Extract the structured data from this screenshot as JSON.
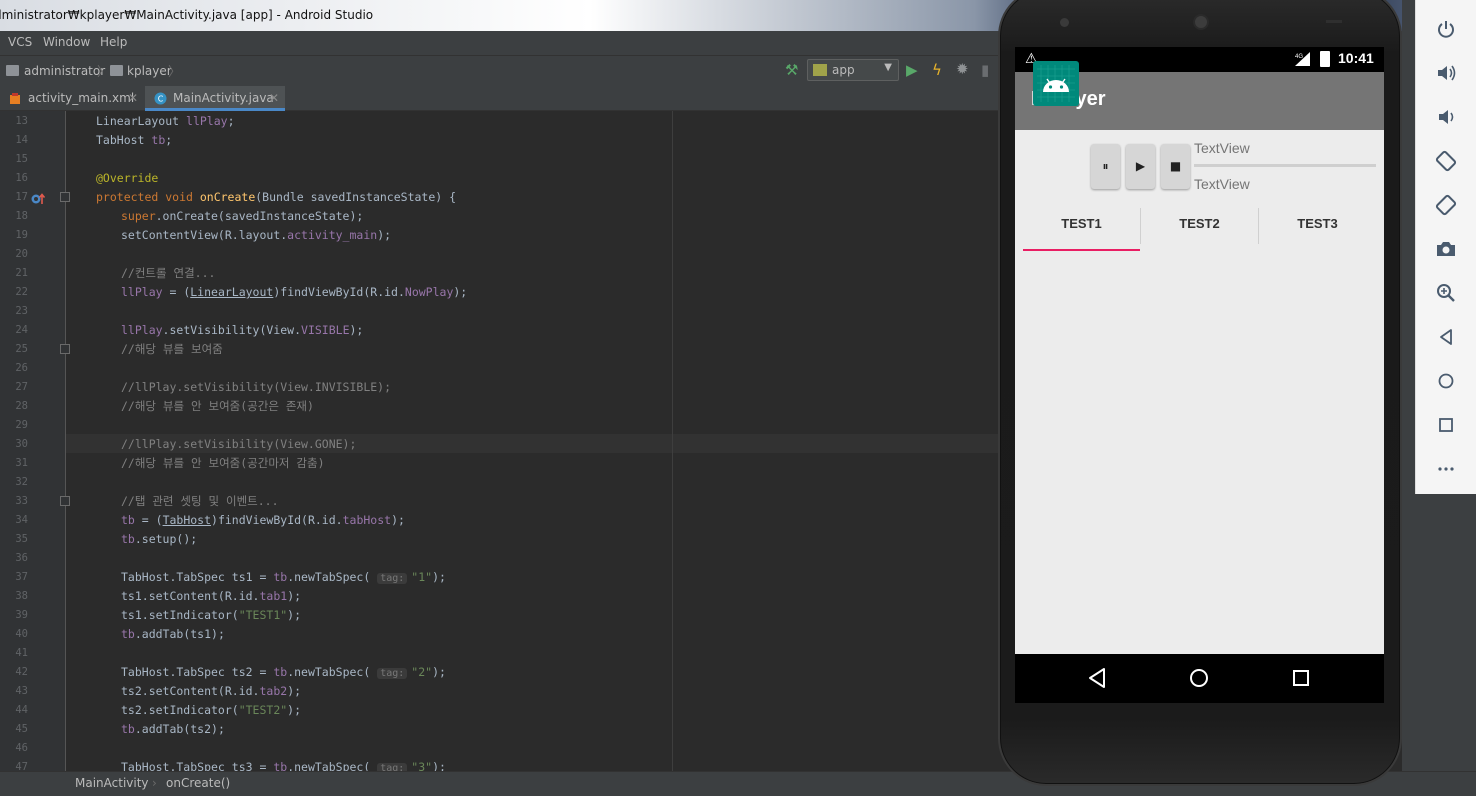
{
  "window": {
    "title": "dministrator₩kplayer₩MainActivity.java [app] - Android Studio"
  },
  "menu": [
    "VCS",
    "Window",
    "Help"
  ],
  "nav": {
    "crumbs": [
      "administrator",
      "kplayer"
    ],
    "run_config": "app"
  },
  "editor_tabs": [
    {
      "label": "activity_main.xml",
      "active": false
    },
    {
      "label": "MainActivity.java",
      "active": true
    }
  ],
  "code_lines": [
    {
      "n": "13",
      "indent": 1,
      "html": "LinearLayout <span class=\"fld\">llPlay</span>;"
    },
    {
      "n": "14",
      "indent": 1,
      "html": "TabHost <span class=\"fld\">tb</span>;"
    },
    {
      "n": "15",
      "indent": 1,
      "html": ""
    },
    {
      "n": "16",
      "indent": 1,
      "html": "<span class=\"ann\">@Override</span>"
    },
    {
      "n": "17",
      "indent": 1,
      "html": "<span class=\"kw\">protected void </span><span class=\"mth\">onCreate</span>(Bundle savedInstanceState) {"
    },
    {
      "n": "18",
      "indent": 2,
      "html": "<span class=\"kw\">super</span>.onCreate(savedInstanceState);"
    },
    {
      "n": "19",
      "indent": 2,
      "html": "setContentView(R.layout.<span class=\"fld\">activity_main</span>);"
    },
    {
      "n": "20",
      "indent": 2,
      "html": ""
    },
    {
      "n": "21",
      "indent": 2,
      "html": "<span class=\"cm\">//컨트롤 연결...</span>"
    },
    {
      "n": "22",
      "indent": 2,
      "html": "<span class=\"fld\">llPlay</span> = (<u>LinearLayout</u>)findViewById(R.id.<span class=\"fld\">NowPlay</span>);"
    },
    {
      "n": "23",
      "indent": 2,
      "html": ""
    },
    {
      "n": "24",
      "indent": 2,
      "html": "<span class=\"fld\">llPlay</span>.setVisibility(View.<span class=\"fld\">VISIBLE</span>);"
    },
    {
      "n": "25",
      "indent": 2,
      "html": "<span class=\"cm\">//해당 뷰를 보여줌</span>"
    },
    {
      "n": "26",
      "indent": 2,
      "html": ""
    },
    {
      "n": "27",
      "indent": 2,
      "html": "<span class=\"cm\">//llPlay.setVisibility(View.INVISIBLE);</span>"
    },
    {
      "n": "28",
      "indent": 2,
      "html": "<span class=\"cm\">//해당 뷰를 안 보여줌(공간은 존재)</span>"
    },
    {
      "n": "29",
      "indent": 2,
      "html": ""
    },
    {
      "n": "30",
      "indent": 2,
      "html": "<span class=\"cm\">//llPlay.setVisibility(View.GONE);</span>"
    },
    {
      "n": "31",
      "indent": 2,
      "html": "<span class=\"cm\">//해당 뷰를 안 보여줌(공간마저 감춤)</span>"
    },
    {
      "n": "32",
      "indent": 2,
      "html": ""
    },
    {
      "n": "33",
      "indent": 2,
      "html": "<span class=\"cm\">//탭 관련 셋팅 및 이벤트...</span>"
    },
    {
      "n": "34",
      "indent": 2,
      "html": "<span class=\"fld\">tb</span> = (<u>TabHost</u>)findViewById(R.id.<span class=\"fld\">tabHost</span>);"
    },
    {
      "n": "35",
      "indent": 2,
      "html": "<span class=\"fld\">tb</span>.setup();"
    },
    {
      "n": "36",
      "indent": 2,
      "html": ""
    },
    {
      "n": "37",
      "indent": 2,
      "html": "TabHost.TabSpec ts1 = <span class=\"fld\">tb</span>.newTabSpec( <span class=\"hint\">tag:</span><span class=\"str\">\"1\"</span>);"
    },
    {
      "n": "38",
      "indent": 2,
      "html": "ts1.setContent(R.id.<span class=\"fld\">tab1</span>);"
    },
    {
      "n": "39",
      "indent": 2,
      "html": "ts1.setIndicator(<span class=\"str\">\"TEST1\"</span>);"
    },
    {
      "n": "40",
      "indent": 2,
      "html": "<span class=\"fld\">tb</span>.addTab(ts1);"
    },
    {
      "n": "41",
      "indent": 2,
      "html": ""
    },
    {
      "n": "42",
      "indent": 2,
      "html": "TabHost.TabSpec ts2 = <span class=\"fld\">tb</span>.newTabSpec( <span class=\"hint\">tag:</span><span class=\"str\">\"2\"</span>);"
    },
    {
      "n": "43",
      "indent": 2,
      "html": "ts2.setContent(R.id.<span class=\"fld\">tab2</span>);"
    },
    {
      "n": "44",
      "indent": 2,
      "html": "ts2.setIndicator(<span class=\"str\">\"TEST2\"</span>);"
    },
    {
      "n": "45",
      "indent": 2,
      "html": "<span class=\"fld\">tb</span>.addTab(ts2);"
    },
    {
      "n": "46",
      "indent": 2,
      "html": ""
    },
    {
      "n": "47",
      "indent": 2,
      "html": "TabHost.TabSpec ts3 = <span class=\"fld\">tb</span>.newTabSpec( <span class=\"hint\">tag:</span><span class=\"str\">\"3\"</span>);"
    }
  ],
  "statusbar": {
    "breadcrumb": [
      "MainActivity",
      "onCreate()"
    ]
  },
  "device": {
    "status_time": "10:41",
    "network": "4G",
    "app_title": "KPlayer",
    "player": {
      "text_top": "TextView",
      "text_bottom": "TextView",
      "pause_label": "⏸",
      "play_label": "▶",
      "stop_label": "■"
    },
    "tabs": [
      "TEST1",
      "TEST2",
      "TEST3"
    ],
    "selected_tab": "TEST1"
  },
  "emulator_toolbar": [
    "power-icon",
    "volume-up-icon",
    "volume-down-icon",
    "rotate-left-icon",
    "rotate-right-icon",
    "camera-icon",
    "zoom-icon",
    "back-icon",
    "home-icon",
    "overview-icon",
    "more-icon"
  ],
  "colors": {
    "accent_tab": "#e91e63",
    "app_bar": "#757575",
    "album_art": "#00897b",
    "editor_bg": "#2b2b2b"
  }
}
